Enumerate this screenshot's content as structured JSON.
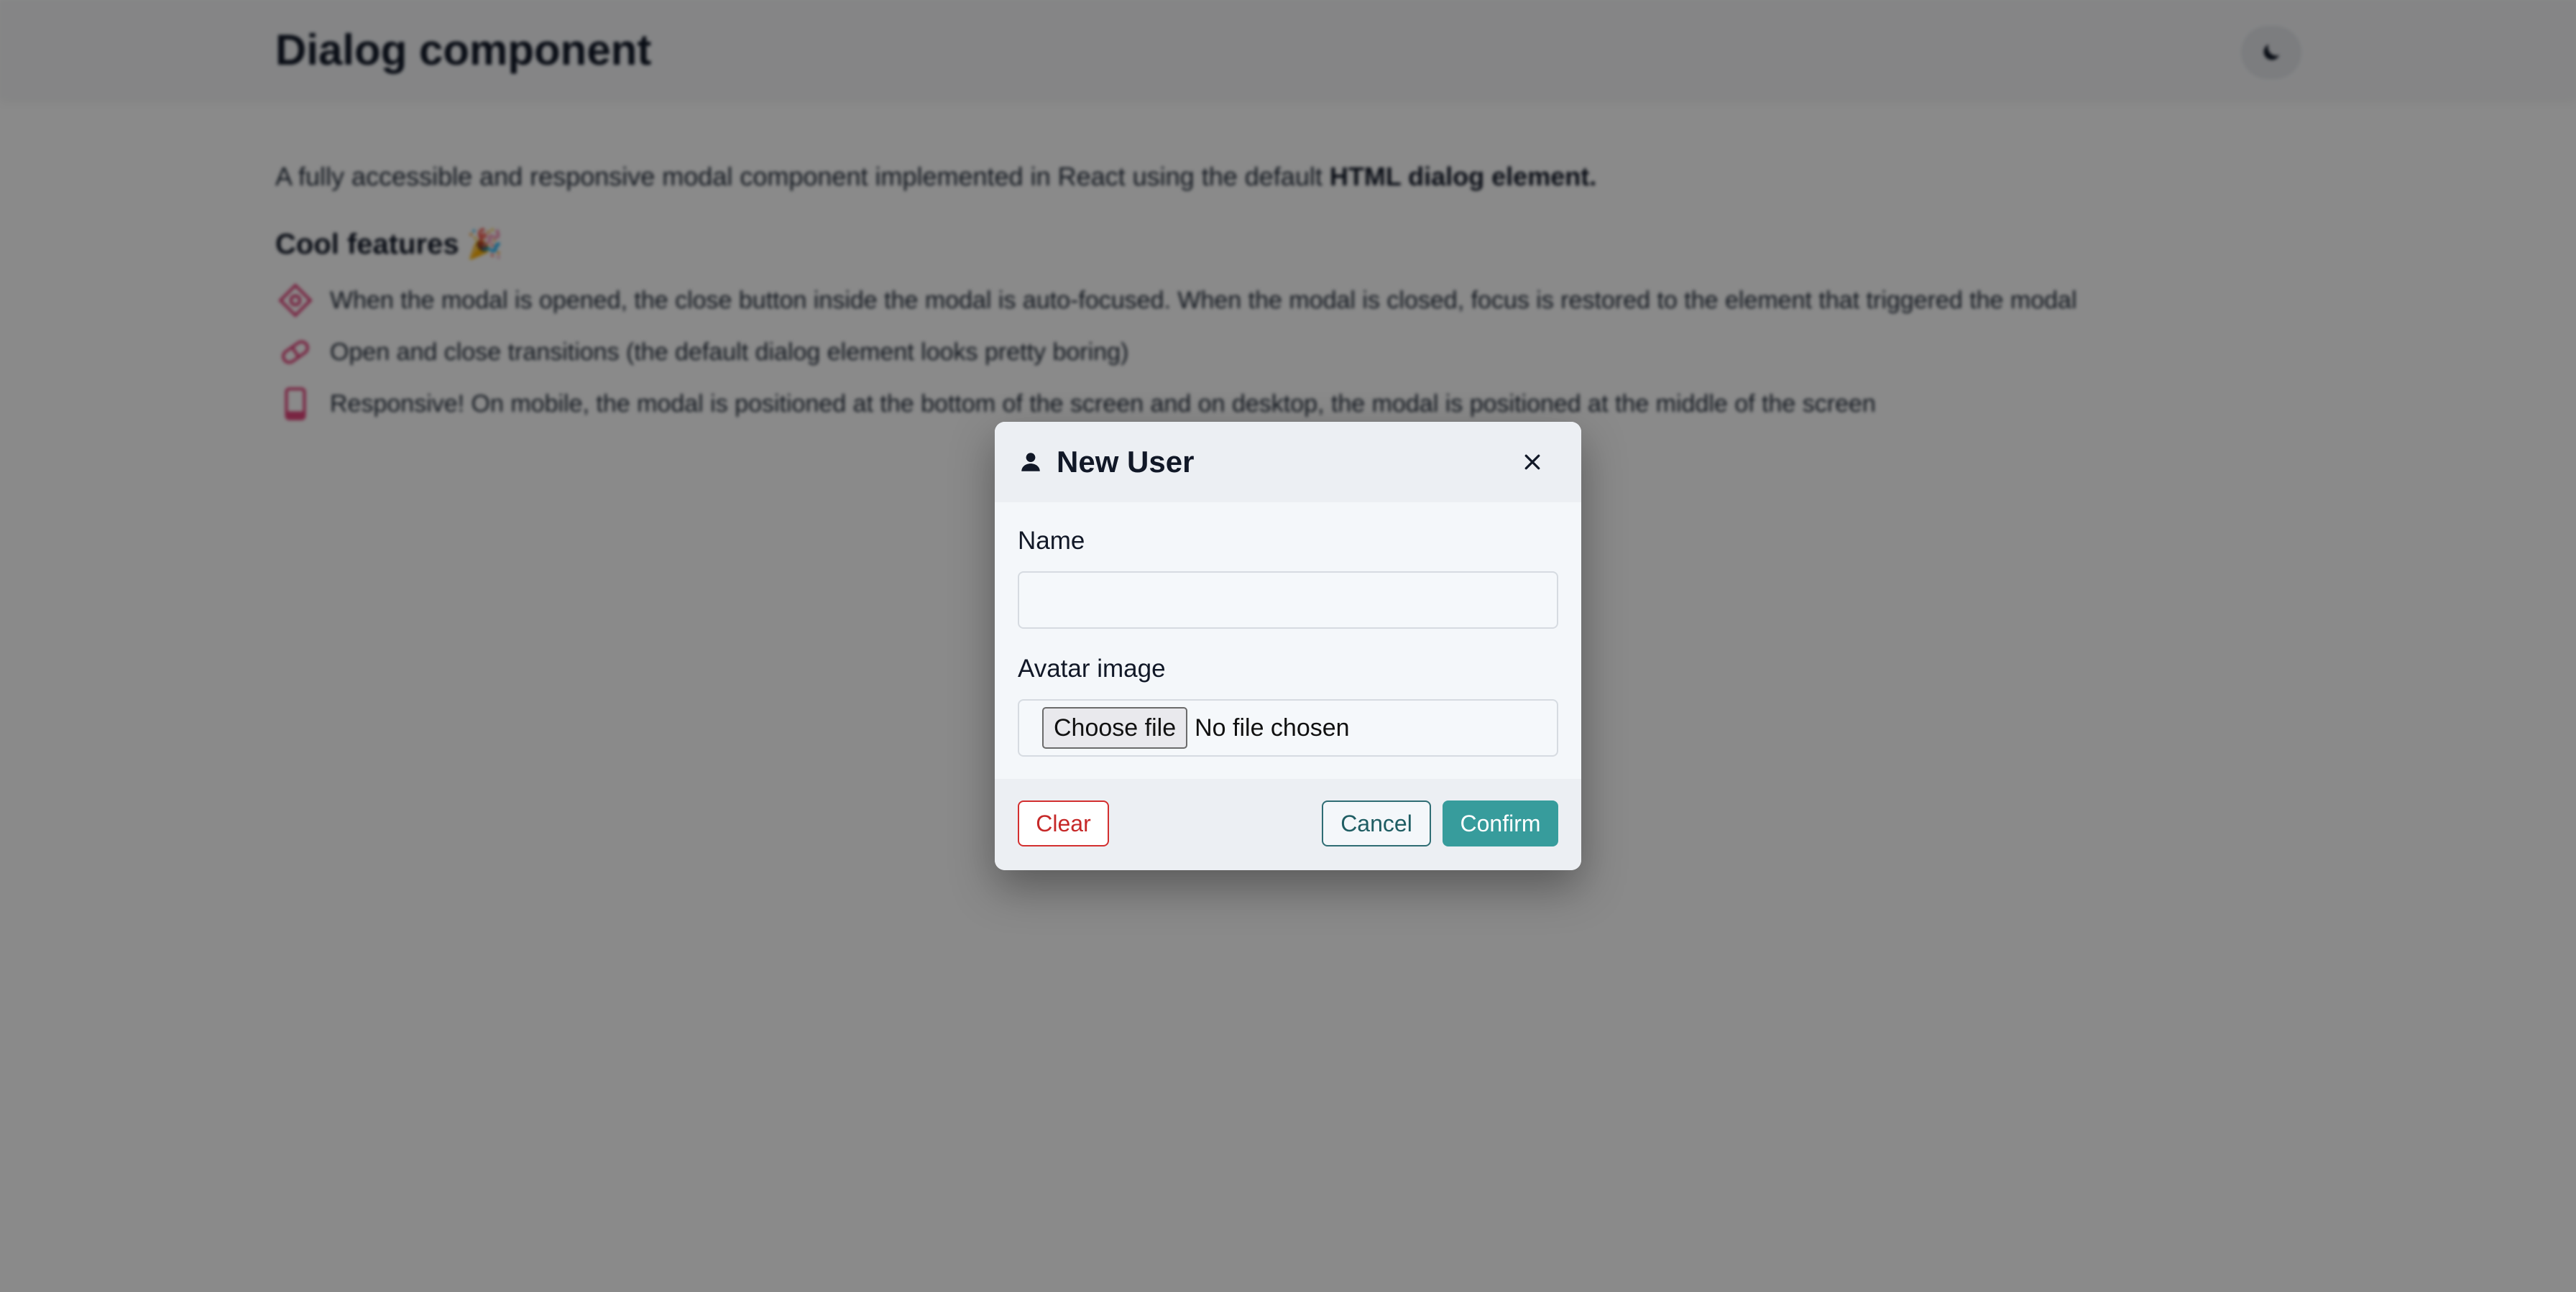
{
  "page": {
    "title": "Dialog component",
    "theme_toggle_icon": "moon-icon",
    "intro_text": "A fully accessible and responsive modal component implemented in React using the default ",
    "intro_strong": "HTML dialog element.",
    "features_title": "Cool features 🎉",
    "features": [
      {
        "icon": "focus-target-icon",
        "text": "When the modal is opened, the close button inside the modal is auto-focused. When the modal is closed, focus is restored to the element that triggered the modal"
      },
      {
        "icon": "pill-icon",
        "text": "Open and close transitions (the default dialog element looks pretty boring)"
      },
      {
        "icon": "mobile-phone-icon",
        "text": "Responsive! On mobile, the modal is positioned at the bottom of the screen and on desktop, the modal is positioned at the middle of the screen"
      }
    ]
  },
  "dialog": {
    "icon": "user-icon",
    "title": "New User",
    "close_icon": "close-icon",
    "fields": {
      "name": {
        "label": "Name",
        "value": "",
        "placeholder": ""
      },
      "avatar": {
        "label": "Avatar image",
        "button_label": "Choose file",
        "status": "No file chosen"
      }
    },
    "buttons": {
      "clear": "Clear",
      "cancel": "Cancel",
      "confirm": "Confirm"
    }
  },
  "colors": {
    "accent": "#379c9c",
    "danger": "#d32f2f",
    "feature_icon": "#e0457b",
    "backdrop": "rgba(0,0,0,0.46)"
  }
}
